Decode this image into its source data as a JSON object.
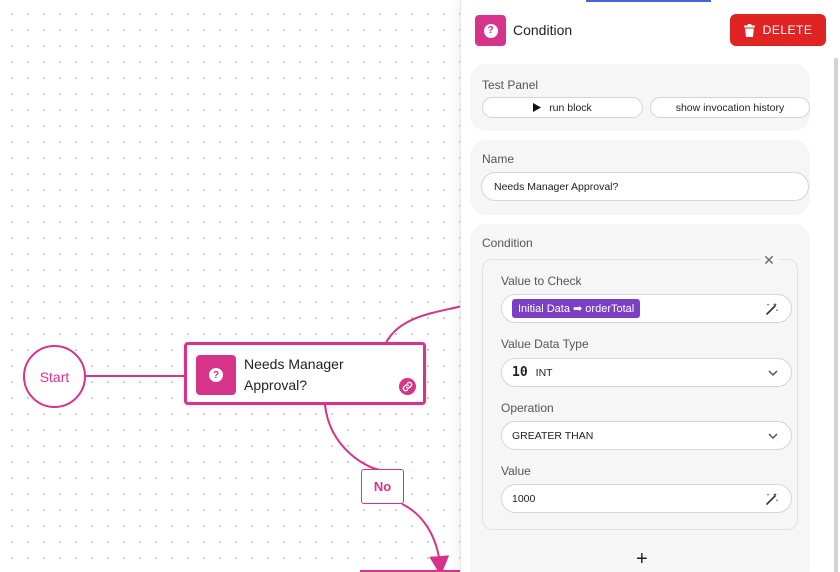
{
  "canvas": {
    "start_label": "Start",
    "block_title": "Needs Manager Approval?",
    "edge_label": "No",
    "accent_color": "#d6338a"
  },
  "panel": {
    "title": "Condition",
    "delete_label": "DELETE",
    "test_panel": {
      "label": "Test Panel",
      "run_label": "run block",
      "history_label": "show invocation history"
    },
    "name_section": {
      "label": "Name",
      "value": "Needs Manager Approval?"
    },
    "condition": {
      "label": "Condition",
      "value_to_check_label": "Value to Check",
      "value_to_check_tag": "Initial Data ➡ orderTotal",
      "data_type_label": "Value Data Type",
      "data_type_glyph": "10",
      "data_type_value": "INT",
      "operation_label": "Operation",
      "operation_value": "GREATER THAN",
      "value_label": "Value",
      "value_value": "1000"
    },
    "add_label": "+"
  },
  "colors": {
    "accent": "#d6338a",
    "delete": "#e02424",
    "tag": "#7b3fc4"
  },
  "icons": [
    "question-icon",
    "link-icon",
    "trash-icon",
    "play-icon",
    "close-icon",
    "magic-wand-icon",
    "chevron-down-icon",
    "plus-icon"
  ]
}
